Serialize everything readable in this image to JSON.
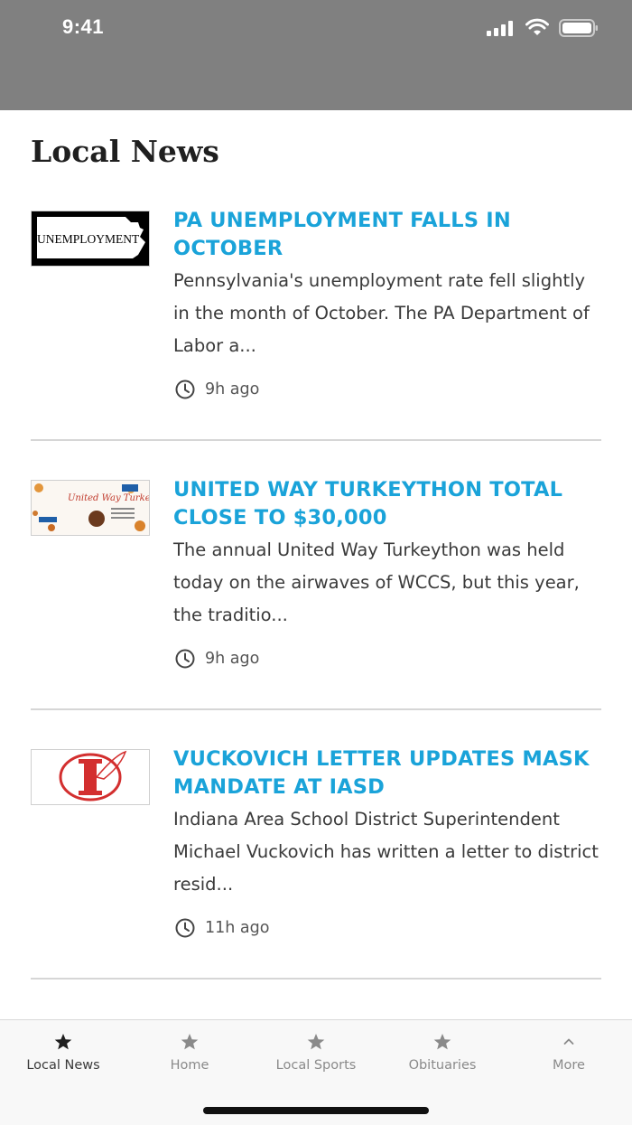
{
  "status_bar": {
    "time": "9:41"
  },
  "page": {
    "title": "Local News"
  },
  "articles": [
    {
      "title": "PA UNEMPLOYMENT FALLS IN OCTOBER",
      "summary": "Pennsylvania's unemployment rate fell slightly in the month of October. The PA Department of Labor a...",
      "time": "9h ago",
      "thumb_text": "UNEMPLOYMENT"
    },
    {
      "title": "UNITED WAY TURKEYTHON TOTAL CLOSE TO $30,000",
      "summary": "The annual United Way Turkeython was held today on the airwaves of WCCS, but this year, the traditio...",
      "time": "9h ago",
      "thumb_text": "United Way Turkeython"
    },
    {
      "title": "VUCKOVICH LETTER UPDATES MASK MANDATE AT IASD",
      "summary": "Indiana Area School District Superintendent Michael Vuckovich has written a letter to district resid...",
      "time": "11h ago"
    }
  ],
  "tabs": [
    {
      "label": "Local News",
      "icon": "star-icon",
      "active": true
    },
    {
      "label": "Home",
      "icon": "star-icon"
    },
    {
      "label": "Local Sports",
      "icon": "star-icon"
    },
    {
      "label": "Obituaries",
      "icon": "star-icon"
    },
    {
      "label": "More",
      "icon": "chevron-up-icon"
    }
  ],
  "colors": {
    "header_bg": "#808080",
    "title_accent": "#1aa3d9",
    "tabbar_bg": "#f8f8f8"
  }
}
